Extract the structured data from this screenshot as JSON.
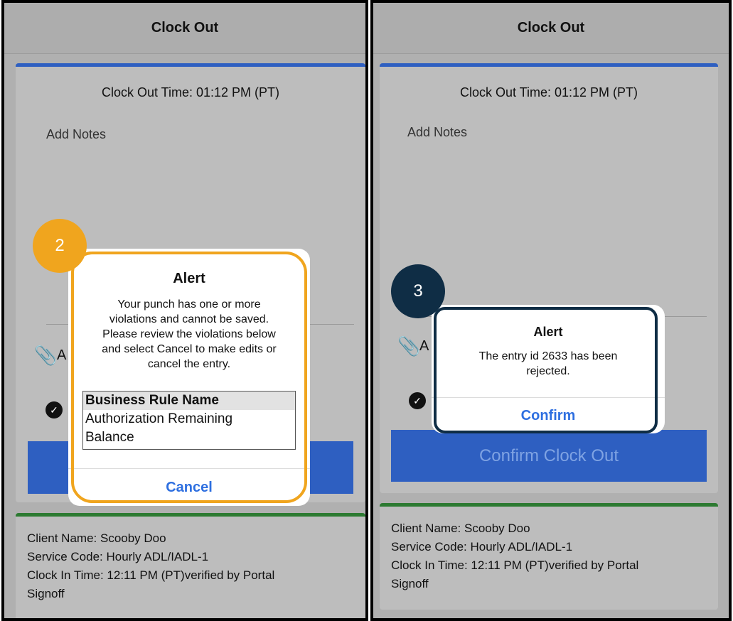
{
  "left_screen": {
    "header_title": "Clock Out",
    "clock_out_time": "Clock Out Time: 01:12 PM (PT)",
    "notes_placeholder": "Add Notes",
    "attachment_partial": "A",
    "client_info": [
      "Client Name: Scooby Doo",
      "Service Code: Hourly ADL/IADL-1",
      "Clock In Time: 12:11 PM (PT)verified by Portal",
      "Signoff"
    ],
    "step_badge": "2",
    "alert": {
      "title": "Alert",
      "message": "Your punch has one or more violations and cannot be saved. Please review the violations below and select Cancel to make edits or cancel the entry.",
      "table_header": "Business Rule Name",
      "table_rows": [
        "Authorization Remaining",
        "Balance"
      ],
      "cancel_label": "Cancel"
    }
  },
  "right_screen": {
    "header_title": "Clock Out",
    "clock_out_time": "Clock Out Time: 01:12 PM (PT)",
    "notes_placeholder": "Add Notes",
    "attachment_partial": "A",
    "confirm_clock_out_label": "Confirm Clock Out",
    "client_info": [
      "Client Name: Scooby Doo",
      "Service Code: Hourly ADL/IADL-1",
      "Clock In Time: 12:11 PM (PT)verified by Portal",
      "Signoff"
    ],
    "step_badge": "3",
    "alert": {
      "title": "Alert",
      "message": "The entry id 2633 has been rejected.",
      "confirm_label": "Confirm"
    }
  },
  "colors": {
    "accent_blue": "#2e5fc1",
    "card_top_green": "#2c7a31",
    "highlight_orange": "#f0a51e",
    "highlight_navy": "#0f2d45",
    "link_blue": "#2e6fe0"
  },
  "icons": [
    "paperclip-icon",
    "checkmark-circle-icon"
  ]
}
